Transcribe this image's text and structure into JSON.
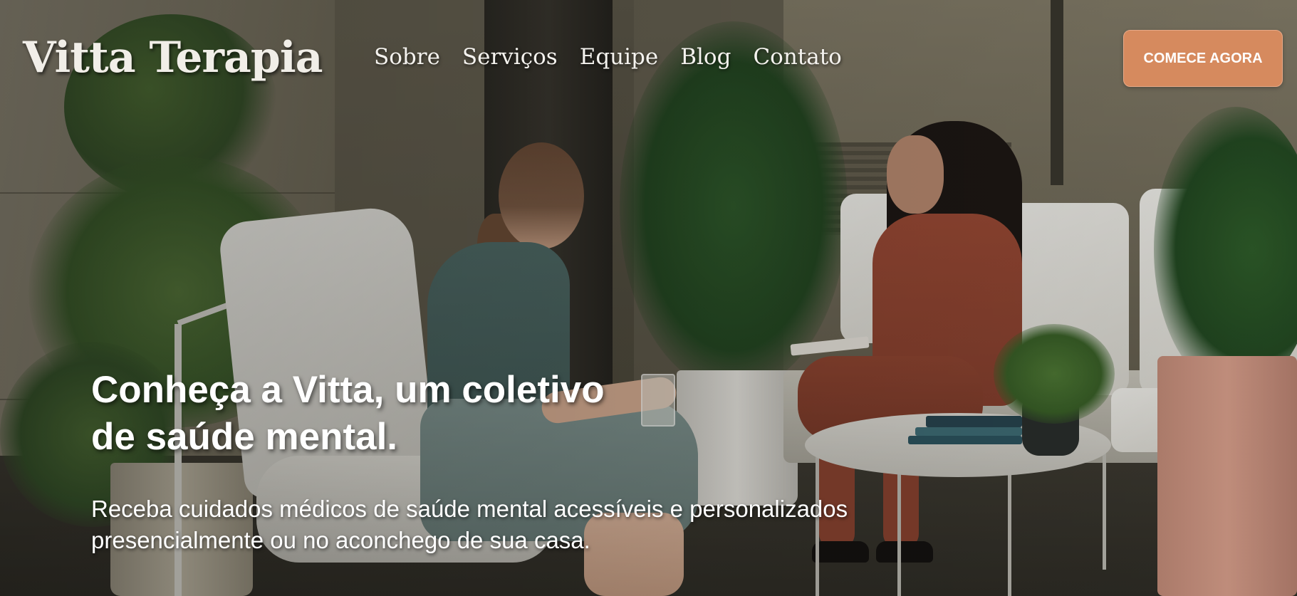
{
  "header": {
    "logo_text": "Vitta Terapia",
    "nav": [
      {
        "label": "Sobre"
      },
      {
        "label": "Serviços"
      },
      {
        "label": "Equipe"
      },
      {
        "label": "Blog"
      },
      {
        "label": "Contato"
      }
    ],
    "cta_label": "COMECE AGORA"
  },
  "hero": {
    "heading": "Conheça a Vitta, um coletivo de saúde mental.",
    "subtitle": "Receba cuidados médicos de saúde mental acessíveis e personalizados presencialmente ou no aconchego de sua casa."
  },
  "colors": {
    "cta_background": "#d68a5e",
    "text": "#ffffff"
  }
}
